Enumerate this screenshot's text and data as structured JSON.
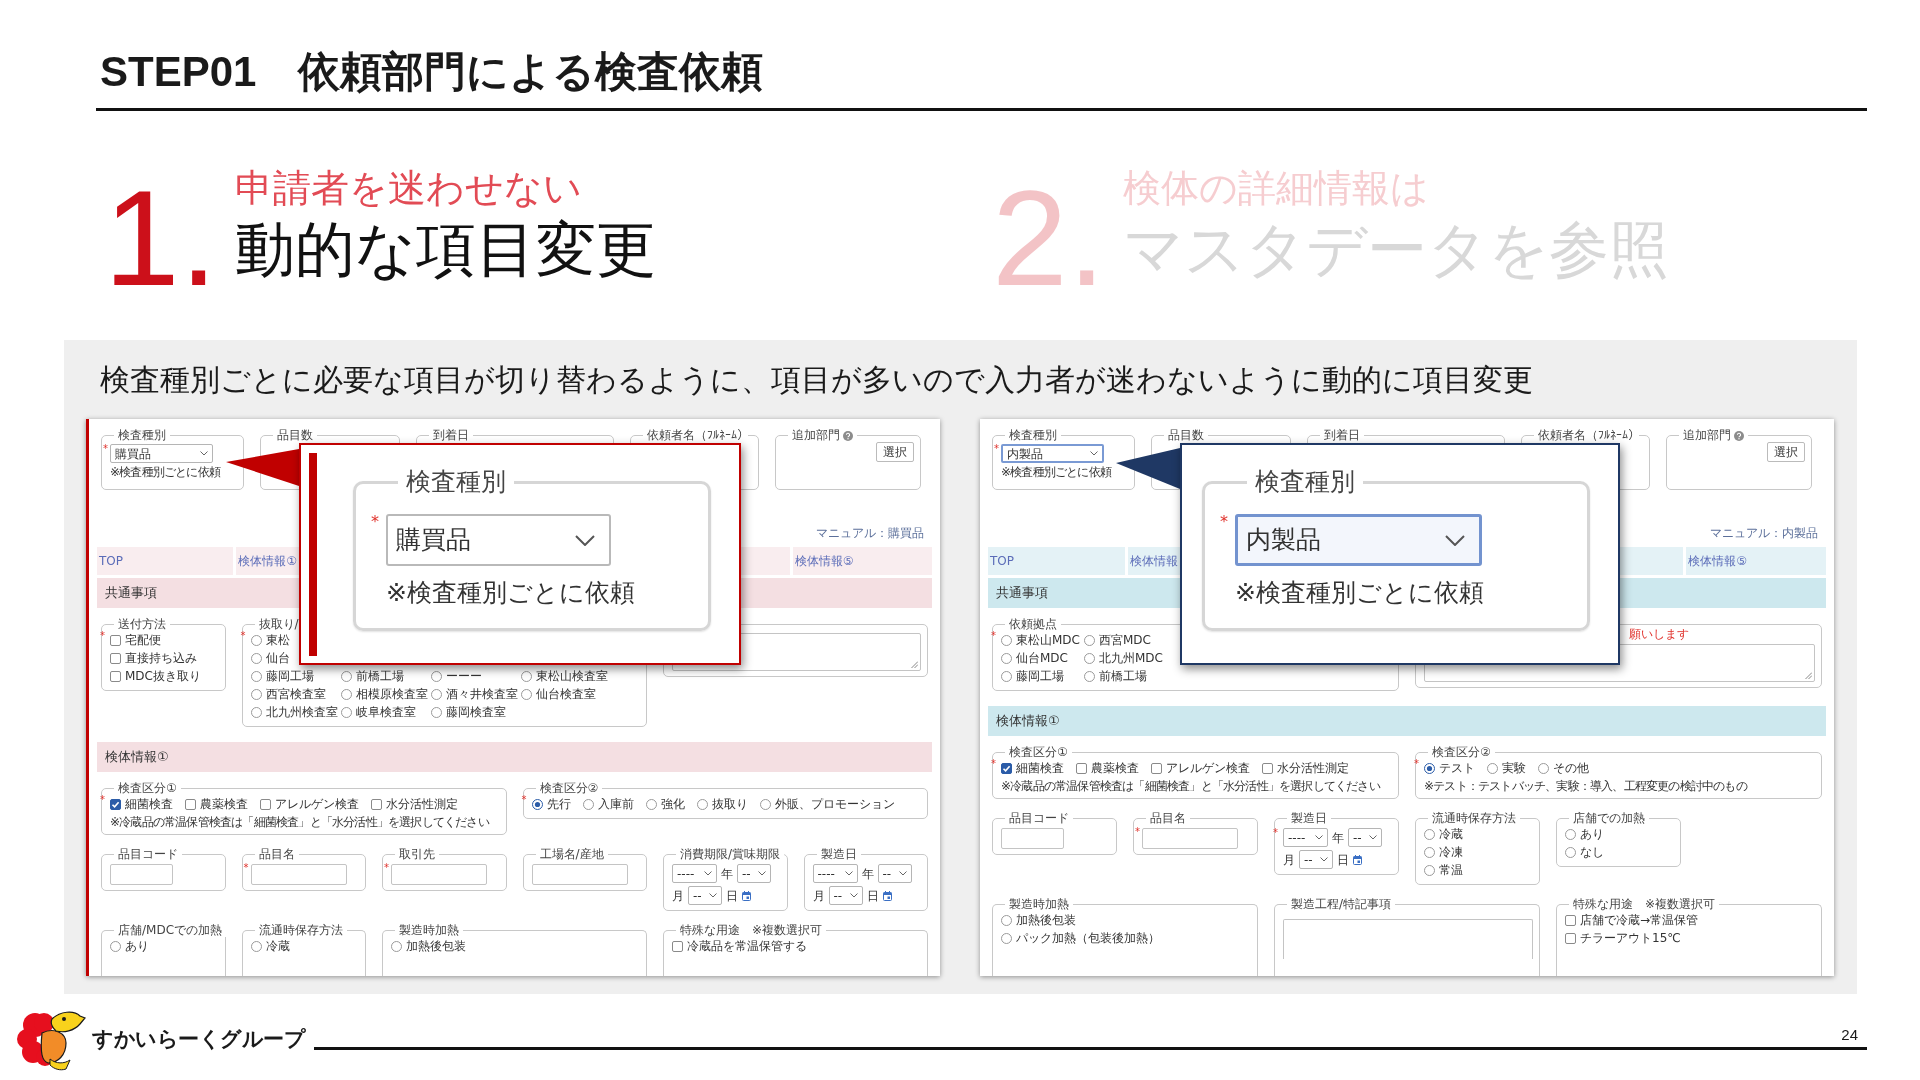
{
  "header": {
    "title": "STEP01　依頼部門による検査依頼"
  },
  "points": [
    {
      "number": "1.",
      "subtitle": "申請者を迷わせない",
      "title": "動的な項目変更",
      "active": true
    },
    {
      "number": "2.",
      "subtitle": "検体の詳細情報は",
      "title": "マスタデータを参照",
      "active": false
    }
  ],
  "panel": {
    "caption": "検査種別ごとに必要な項目が切り替わるように、項目が多いので入力者が迷わないように動的に項目変更",
    "screens": [
      {
        "color": "#c00000",
        "band": {
          "color": "#f4dfe2"
        },
        "highlighted": true,
        "top_fields": [
          {
            "label": "検査種別",
            "kind": "select",
            "required_mark": "*",
            "value": "購買品",
            "focused": false,
            "note": "※検査種別ごとに依頼"
          },
          {
            "label": "品目数",
            "kind": "covered"
          },
          {
            "label": "到着日",
            "kind": "covered"
          },
          {
            "label": "依頼者名（ﾌﾙﾈｰﾑ）",
            "kind": "covered"
          },
          {
            "label": "追加部門",
            "kind": "button",
            "help": true,
            "button": "選択"
          }
        ],
        "manual": "マニュアル：購買品",
        "tabs": [
          {
            "label": "TOP"
          },
          {
            "label": "検体情報①"
          },
          {
            "label": "検体情報⑤"
          }
        ],
        "sections": [
          {
            "title": "共通事項",
            "fields": [
              {
                "label": "送付方法",
                "kind": "checks",
                "required_mark": "*",
                "option_rows": [
                  [
                    {
                      "label": "宅配便",
                      "checked": false
                    }
                  ],
                  [
                    {
                      "label": "直接持ち込み",
                      "checked": false
                    }
                  ],
                  [
                    {
                      "label": "MDC抜き取り",
                      "checked": false
                    }
                  ]
                ]
              },
              {
                "label": "抜取り/",
                "kind": "radios",
                "required_mark": "*",
                "option_rows": [
                  [
                    {
                      "label": "東松",
                      "selected": false
                    }
                  ],
                  [
                    {
                      "label": "仙台",
                      "selected": false
                    }
                  ],
                  [
                    {
                      "label": "藤岡工場",
                      "selected": false
                    },
                    {
                      "label": "前橋工場",
                      "selected": false
                    },
                    {
                      "label": "ーーー",
                      "selected": false
                    },
                    {
                      "label": "東松山検査室",
                      "selected": false
                    }
                  ],
                  [
                    {
                      "label": "西宮検査室",
                      "selected": false
                    },
                    {
                      "label": "相模原検査室",
                      "selected": false
                    },
                    {
                      "label": "酒々井検査室",
                      "selected": false
                    },
                    {
                      "label": "仙台検査室",
                      "selected": false
                    }
                  ],
                  [
                    {
                      "label": "北九州検査室",
                      "selected": false
                    },
                    {
                      "label": "岐阜検査室",
                      "selected": false
                    },
                    {
                      "label": "藤岡検査室",
                      "selected": false
                    }
                  ]
                ]
              },
              {
                "kind": "textarea"
              }
            ]
          },
          {
            "title": "検体情報①",
            "fields": [
              {
                "label": "検査区分①",
                "kind": "checks",
                "required_mark": "*",
                "option_rows": [
                  [
                    {
                      "label": "細菌検査",
                      "checked": true
                    },
                    {
                      "label": "農薬検査",
                      "checked": false
                    },
                    {
                      "label": "アレルゲン検査",
                      "checked": false
                    },
                    {
                      "label": "水分活性測定",
                      "checked": false
                    }
                  ]
                ],
                "note": "※冷蔵品の常温保管検査は「細菌検査」と「水分活性」を選択してください"
              },
              {
                "label": "検査区分②",
                "kind": "radios",
                "required_mark": "*",
                "option_rows": [
                  [
                    {
                      "label": "先行",
                      "selected": true
                    },
                    {
                      "label": "入庫前",
                      "selected": false
                    },
                    {
                      "label": "強化",
                      "selected": false
                    },
                    {
                      "label": "抜取り",
                      "selected": false
                    },
                    {
                      "label": "外販、プロモーション",
                      "selected": false
                    }
                  ]
                ]
              },
              {
                "label": "品目コード",
                "kind": "text"
              },
              {
                "label": "品目名",
                "kind": "text",
                "required_mark": "*"
              },
              {
                "label": "取引先",
                "kind": "text",
                "required_mark": "*"
              },
              {
                "label": "工場名/産地",
                "kind": "text"
              },
              {
                "label": "消費期限/賞味期限",
                "kind": "date",
                "date_rows": [
                  [
                    {
                      "kind": "select",
                      "value": "----"
                    },
                    {
                      "kind": "unit",
                      "text": "年"
                    },
                    {
                      "kind": "select",
                      "value": "--"
                    }
                  ],
                  [
                    {
                      "kind": "unit",
                      "text": "月"
                    },
                    {
                      "kind": "select",
                      "value": "--"
                    },
                    {
                      "kind": "unit",
                      "text": "日"
                    },
                    {
                      "kind": "calendar"
                    }
                  ]
                ]
              },
              {
                "label": "製造日",
                "kind": "date",
                "date_rows": [
                  [
                    {
                      "kind": "select",
                      "value": "----"
                    },
                    {
                      "kind": "unit",
                      "text": "年"
                    },
                    {
                      "kind": "select",
                      "value": "--"
                    }
                  ],
                  [
                    {
                      "kind": "unit",
                      "text": "月"
                    },
                    {
                      "kind": "select",
                      "value": "--"
                    },
                    {
                      "kind": "unit",
                      "text": "日"
                    },
                    {
                      "kind": "calendar"
                    }
                  ]
                ]
              },
              {
                "label": "店舗/MDCでの加熱",
                "kind": "radios",
                "option_rows": [
                  [
                    {
                      "label": "あり",
                      "selected": false
                    }
                  ]
                ]
              },
              {
                "label": "流通時保存方法",
                "kind": "radios",
                "option_rows": [
                  [
                    {
                      "label": "冷蔵",
                      "selected": false
                    }
                  ]
                ]
              },
              {
                "label": "製造時加熱",
                "kind": "radios",
                "option_rows": [
                  [
                    {
                      "label": "加熱後包装",
                      "selected": false
                    }
                  ]
                ]
              },
              {
                "label": "特殊な用途　※複数選択可",
                "kind": "checks",
                "option_rows": [
                  [
                    {
                      "label": "冷蔵品を常温保管する",
                      "checked": false
                    }
                  ]
                ]
              }
            ]
          }
        ],
        "popup": {
          "label": "検査種別",
          "required_mark": "*",
          "value": "購買品",
          "focused": false,
          "note": "※検査種別ごとに依頼"
        }
      },
      {
        "color": "#1f3864",
        "band": {
          "color": "#cde8ee"
        },
        "highlighted": false,
        "top_fields": [
          {
            "label": "検査種別",
            "kind": "select",
            "required_mark": "*",
            "value": "内製品",
            "focused": true,
            "note": "※検査種別ごとに依頼"
          },
          {
            "label": "品目数",
            "kind": "covered"
          },
          {
            "label": "到着日",
            "kind": "covered"
          },
          {
            "label": "依頼者名（ﾌﾙﾈｰﾑ）",
            "kind": "covered"
          },
          {
            "label": "追加部門",
            "kind": "button",
            "help": true,
            "button": "選択"
          }
        ],
        "manual": "マニュアル：内製品",
        "tabs": [
          {
            "label": "TOP"
          },
          {
            "label": "検体情報"
          },
          {
            "label": "検体情報⑤"
          }
        ],
        "sections": [
          {
            "title": "共通事項",
            "fields": [
              {
                "label": "依頼拠点",
                "kind": "radios",
                "required_mark": "*",
                "option_rows": [
                  [
                    {
                      "label": "東松山MDC",
                      "selected": false
                    },
                    {
                      "label": "西宮MDC",
                      "selected": false
                    }
                  ],
                  [
                    {
                      "label": "仙台MDC",
                      "selected": false
                    },
                    {
                      "label": "北九州MDC",
                      "selected": false
                    }
                  ],
                  [
                    {
                      "label": "藤岡工場",
                      "selected": false
                    },
                    {
                      "label": "前橋工場",
                      "selected": false
                    }
                  ]
                ]
              },
              {
                "kind": "textarea",
                "note": "願いします"
              }
            ]
          },
          {
            "title": "検体情報①",
            "fields": [
              {
                "label": "検査区分①",
                "kind": "checks",
                "required_mark": "*",
                "option_rows": [
                  [
                    {
                      "label": "細菌検査",
                      "checked": true
                    },
                    {
                      "label": "農薬検査",
                      "checked": false
                    },
                    {
                      "label": "アレルゲン検査",
                      "checked": false
                    },
                    {
                      "label": "水分活性測定",
                      "checked": false
                    }
                  ]
                ],
                "note": "※冷蔵品の常温保管検査は「細菌検査」と「水分活性」を選択してください"
              },
              {
                "label": "検査区分②",
                "kind": "radios",
                "required_mark": "*",
                "option_rows": [
                  [
                    {
                      "label": "テスト",
                      "selected": true
                    },
                    {
                      "label": "実験",
                      "selected": false
                    },
                    {
                      "label": "その他",
                      "selected": false
                    }
                  ]
                ],
                "note": "※テスト：テストバッチ、実験：導入、工程変更の検討中のもの"
              },
              {
                "label": "品目コード",
                "kind": "text"
              },
              {
                "label": "品目名",
                "kind": "text",
                "required_mark": "*"
              },
              {
                "label": "製造日",
                "kind": "date",
                "required_mark": "*",
                "date_rows": [
                  [
                    {
                      "kind": "select",
                      "value": "----"
                    },
                    {
                      "kind": "unit",
                      "text": "年"
                    },
                    {
                      "kind": "select",
                      "value": "--"
                    }
                  ],
                  [
                    {
                      "kind": "unit",
                      "text": "月"
                    },
                    {
                      "kind": "select",
                      "value": "--"
                    },
                    {
                      "kind": "unit",
                      "text": "日"
                    },
                    {
                      "kind": "calendar"
                    }
                  ]
                ]
              },
              {
                "label": "流通時保存方法",
                "kind": "radios",
                "option_rows": [
                  [
                    {
                      "label": "冷蔵",
                      "selected": false
                    }
                  ],
                  [
                    {
                      "label": "冷凍",
                      "selected": false
                    }
                  ],
                  [
                    {
                      "label": "常温",
                      "selected": false
                    }
                  ]
                ]
              },
              {
                "label": "店舗での加熱",
                "kind": "radios",
                "option_rows": [
                  [
                    {
                      "label": "あり",
                      "selected": false
                    }
                  ],
                  [
                    {
                      "label": "なし",
                      "selected": false
                    }
                  ]
                ]
              },
              {
                "label": "製造時加熱",
                "kind": "radios",
                "option_rows": [
                  [
                    {
                      "label": "加熱後包装",
                      "selected": false
                    }
                  ],
                  [
                    {
                      "label": "パック加熱（包装後加熱）",
                      "selected": false
                    }
                  ]
                ]
              },
              {
                "label": "製造工程/特記事項",
                "kind": "textarea"
              },
              {
                "label": "特殊な用途　※複数選択可",
                "kind": "checks",
                "option_rows": [
                  [
                    {
                      "label": "店舗で冷蔵→常温保管",
                      "checked": false
                    }
                  ],
                  [
                    {
                      "label": "チラーアウト15℃",
                      "checked": false
                    }
                  ]
                ]
              }
            ]
          }
        ],
        "popup": {
          "label": "検査種別",
          "required_mark": "*",
          "value": "内製品",
          "focused": true,
          "note": "※検査種別ごとに依頼"
        }
      }
    ]
  },
  "footer": {
    "logo_text": "すかいらーくグループ",
    "page_number": "24"
  }
}
